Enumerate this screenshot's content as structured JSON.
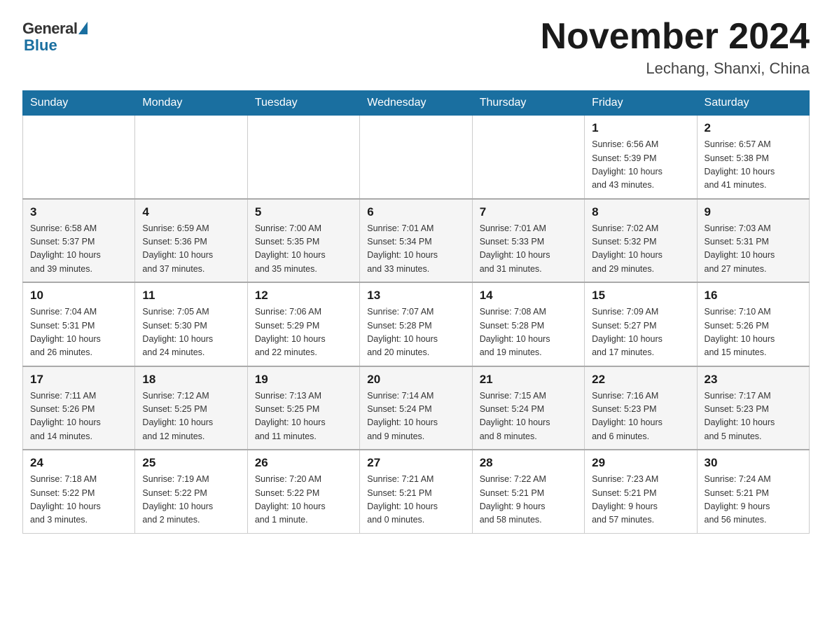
{
  "header": {
    "logo_general": "General",
    "logo_blue": "Blue",
    "month_title": "November 2024",
    "location": "Lechang, Shanxi, China"
  },
  "days_of_week": [
    "Sunday",
    "Monday",
    "Tuesday",
    "Wednesday",
    "Thursday",
    "Friday",
    "Saturday"
  ],
  "weeks": [
    {
      "days": [
        {
          "num": "",
          "info": ""
        },
        {
          "num": "",
          "info": ""
        },
        {
          "num": "",
          "info": ""
        },
        {
          "num": "",
          "info": ""
        },
        {
          "num": "",
          "info": ""
        },
        {
          "num": "1",
          "info": "Sunrise: 6:56 AM\nSunset: 5:39 PM\nDaylight: 10 hours\nand 43 minutes."
        },
        {
          "num": "2",
          "info": "Sunrise: 6:57 AM\nSunset: 5:38 PM\nDaylight: 10 hours\nand 41 minutes."
        }
      ]
    },
    {
      "days": [
        {
          "num": "3",
          "info": "Sunrise: 6:58 AM\nSunset: 5:37 PM\nDaylight: 10 hours\nand 39 minutes."
        },
        {
          "num": "4",
          "info": "Sunrise: 6:59 AM\nSunset: 5:36 PM\nDaylight: 10 hours\nand 37 minutes."
        },
        {
          "num": "5",
          "info": "Sunrise: 7:00 AM\nSunset: 5:35 PM\nDaylight: 10 hours\nand 35 minutes."
        },
        {
          "num": "6",
          "info": "Sunrise: 7:01 AM\nSunset: 5:34 PM\nDaylight: 10 hours\nand 33 minutes."
        },
        {
          "num": "7",
          "info": "Sunrise: 7:01 AM\nSunset: 5:33 PM\nDaylight: 10 hours\nand 31 minutes."
        },
        {
          "num": "8",
          "info": "Sunrise: 7:02 AM\nSunset: 5:32 PM\nDaylight: 10 hours\nand 29 minutes."
        },
        {
          "num": "9",
          "info": "Sunrise: 7:03 AM\nSunset: 5:31 PM\nDaylight: 10 hours\nand 27 minutes."
        }
      ]
    },
    {
      "days": [
        {
          "num": "10",
          "info": "Sunrise: 7:04 AM\nSunset: 5:31 PM\nDaylight: 10 hours\nand 26 minutes."
        },
        {
          "num": "11",
          "info": "Sunrise: 7:05 AM\nSunset: 5:30 PM\nDaylight: 10 hours\nand 24 minutes."
        },
        {
          "num": "12",
          "info": "Sunrise: 7:06 AM\nSunset: 5:29 PM\nDaylight: 10 hours\nand 22 minutes."
        },
        {
          "num": "13",
          "info": "Sunrise: 7:07 AM\nSunset: 5:28 PM\nDaylight: 10 hours\nand 20 minutes."
        },
        {
          "num": "14",
          "info": "Sunrise: 7:08 AM\nSunset: 5:28 PM\nDaylight: 10 hours\nand 19 minutes."
        },
        {
          "num": "15",
          "info": "Sunrise: 7:09 AM\nSunset: 5:27 PM\nDaylight: 10 hours\nand 17 minutes."
        },
        {
          "num": "16",
          "info": "Sunrise: 7:10 AM\nSunset: 5:26 PM\nDaylight: 10 hours\nand 15 minutes."
        }
      ]
    },
    {
      "days": [
        {
          "num": "17",
          "info": "Sunrise: 7:11 AM\nSunset: 5:26 PM\nDaylight: 10 hours\nand 14 minutes."
        },
        {
          "num": "18",
          "info": "Sunrise: 7:12 AM\nSunset: 5:25 PM\nDaylight: 10 hours\nand 12 minutes."
        },
        {
          "num": "19",
          "info": "Sunrise: 7:13 AM\nSunset: 5:25 PM\nDaylight: 10 hours\nand 11 minutes."
        },
        {
          "num": "20",
          "info": "Sunrise: 7:14 AM\nSunset: 5:24 PM\nDaylight: 10 hours\nand 9 minutes."
        },
        {
          "num": "21",
          "info": "Sunrise: 7:15 AM\nSunset: 5:24 PM\nDaylight: 10 hours\nand 8 minutes."
        },
        {
          "num": "22",
          "info": "Sunrise: 7:16 AM\nSunset: 5:23 PM\nDaylight: 10 hours\nand 6 minutes."
        },
        {
          "num": "23",
          "info": "Sunrise: 7:17 AM\nSunset: 5:23 PM\nDaylight: 10 hours\nand 5 minutes."
        }
      ]
    },
    {
      "days": [
        {
          "num": "24",
          "info": "Sunrise: 7:18 AM\nSunset: 5:22 PM\nDaylight: 10 hours\nand 3 minutes."
        },
        {
          "num": "25",
          "info": "Sunrise: 7:19 AM\nSunset: 5:22 PM\nDaylight: 10 hours\nand 2 minutes."
        },
        {
          "num": "26",
          "info": "Sunrise: 7:20 AM\nSunset: 5:22 PM\nDaylight: 10 hours\nand 1 minute."
        },
        {
          "num": "27",
          "info": "Sunrise: 7:21 AM\nSunset: 5:21 PM\nDaylight: 10 hours\nand 0 minutes."
        },
        {
          "num": "28",
          "info": "Sunrise: 7:22 AM\nSunset: 5:21 PM\nDaylight: 9 hours\nand 58 minutes."
        },
        {
          "num": "29",
          "info": "Sunrise: 7:23 AM\nSunset: 5:21 PM\nDaylight: 9 hours\nand 57 minutes."
        },
        {
          "num": "30",
          "info": "Sunrise: 7:24 AM\nSunset: 5:21 PM\nDaylight: 9 hours\nand 56 minutes."
        }
      ]
    }
  ]
}
